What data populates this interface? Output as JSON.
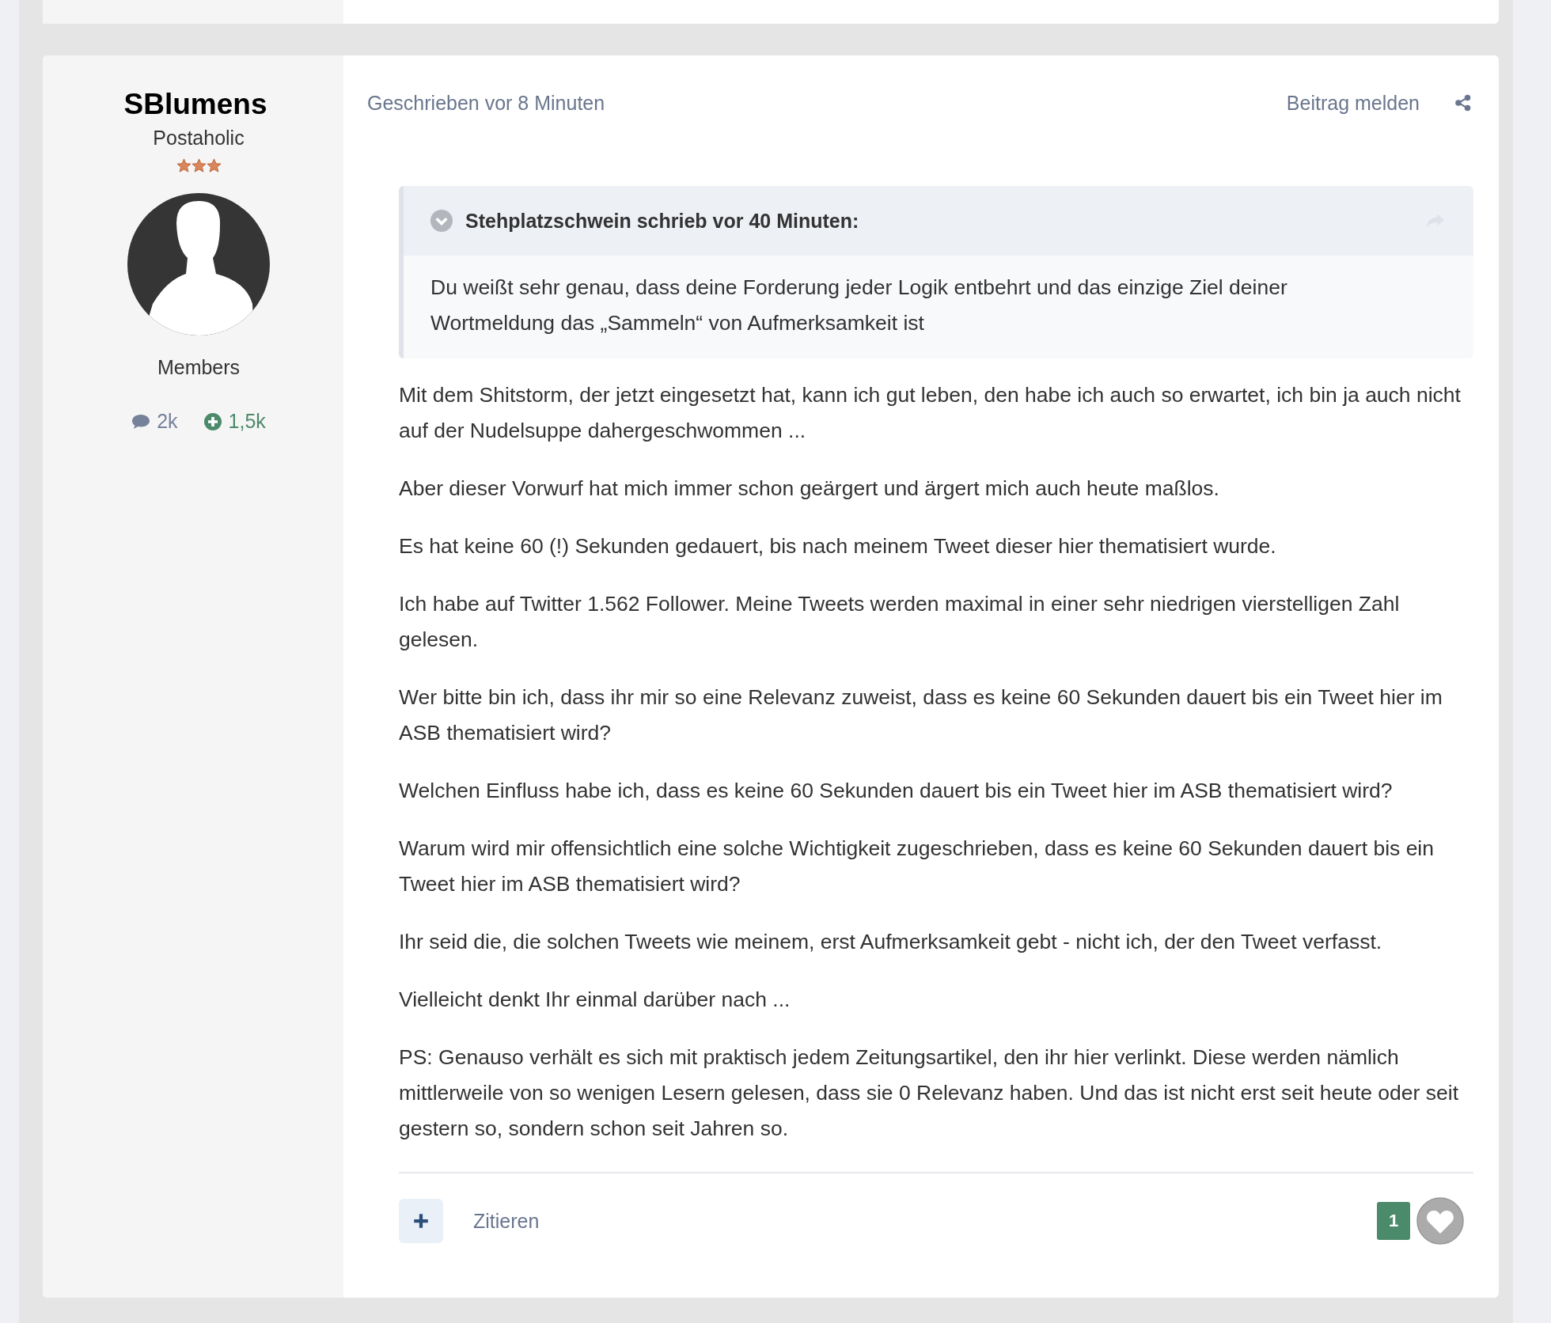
{
  "author": {
    "name": "SBlumens",
    "title": "Postaholic",
    "stars": 3,
    "group": "Members",
    "posts": "2k",
    "reputation": "1,5k"
  },
  "post": {
    "meta": "Geschrieben vor 8 Minuten",
    "report": "Beitrag melden",
    "quote": {
      "citation": "Stehplatzschwein schrieb vor 40 Minuten:",
      "text": "Du weißt sehr genau, dass deine Forderung jeder Logik entbehrt und das einzige Ziel deiner Wortmeldung das „Sammeln“ von Aufmerksamkeit ist"
    },
    "paragraphs": [
      "Mit dem Shitstorm, der jetzt eingesetzt hat, kann ich gut leben, den habe ich auch so erwartet, ich bin ja auch nicht auf der Nudelsuppe dahergeschwommen ...",
      "Aber dieser Vorwurf hat mich immer schon geärgert und ärgert mich auch heute maßlos.",
      "Es hat keine 60 (!) Sekunden gedauert, bis nach meinem Tweet dieser hier thematisiert wurde.",
      "Ich habe auf Twitter 1.562 Follower. Meine Tweets werden maximal in einer sehr niedrigen vierstelligen Zahl gelesen.",
      "Wer bitte bin ich, dass ihr mir so eine Relevanz zuweist, dass es keine 60 Sekunden dauert bis ein Tweet hier im ASB thematisiert wird?",
      "Welchen Einfluss habe ich, dass es keine 60 Sekunden dauert bis ein Tweet hier im ASB thematisiert wird?",
      "Warum wird mir offensichtlich eine solche Wichtigkeit zugeschrieben, dass es keine 60 Sekunden dauert bis ein Tweet hier im ASB thematisiert wird?",
      "Ihr seid die, die solchen Tweets wie meinem, erst Aufmerksamkeit gebt - nicht ich, der den Tweet verfasst.",
      "Vielleicht denkt Ihr einmal darüber nach ...",
      "PS: Genauso verhält es sich mit praktisch jedem Zeitungsartikel, den ihr hier verlinkt. Diese werden nämlich mittlerweile von so wenigen Lesern gelesen, dass sie 0 Relevanz  haben. Und das ist nicht erst seit heute oder seit gestern so, sondern schon seit Jahren so."
    ],
    "quote_action": "Zitieren",
    "reaction_count": "1"
  }
}
